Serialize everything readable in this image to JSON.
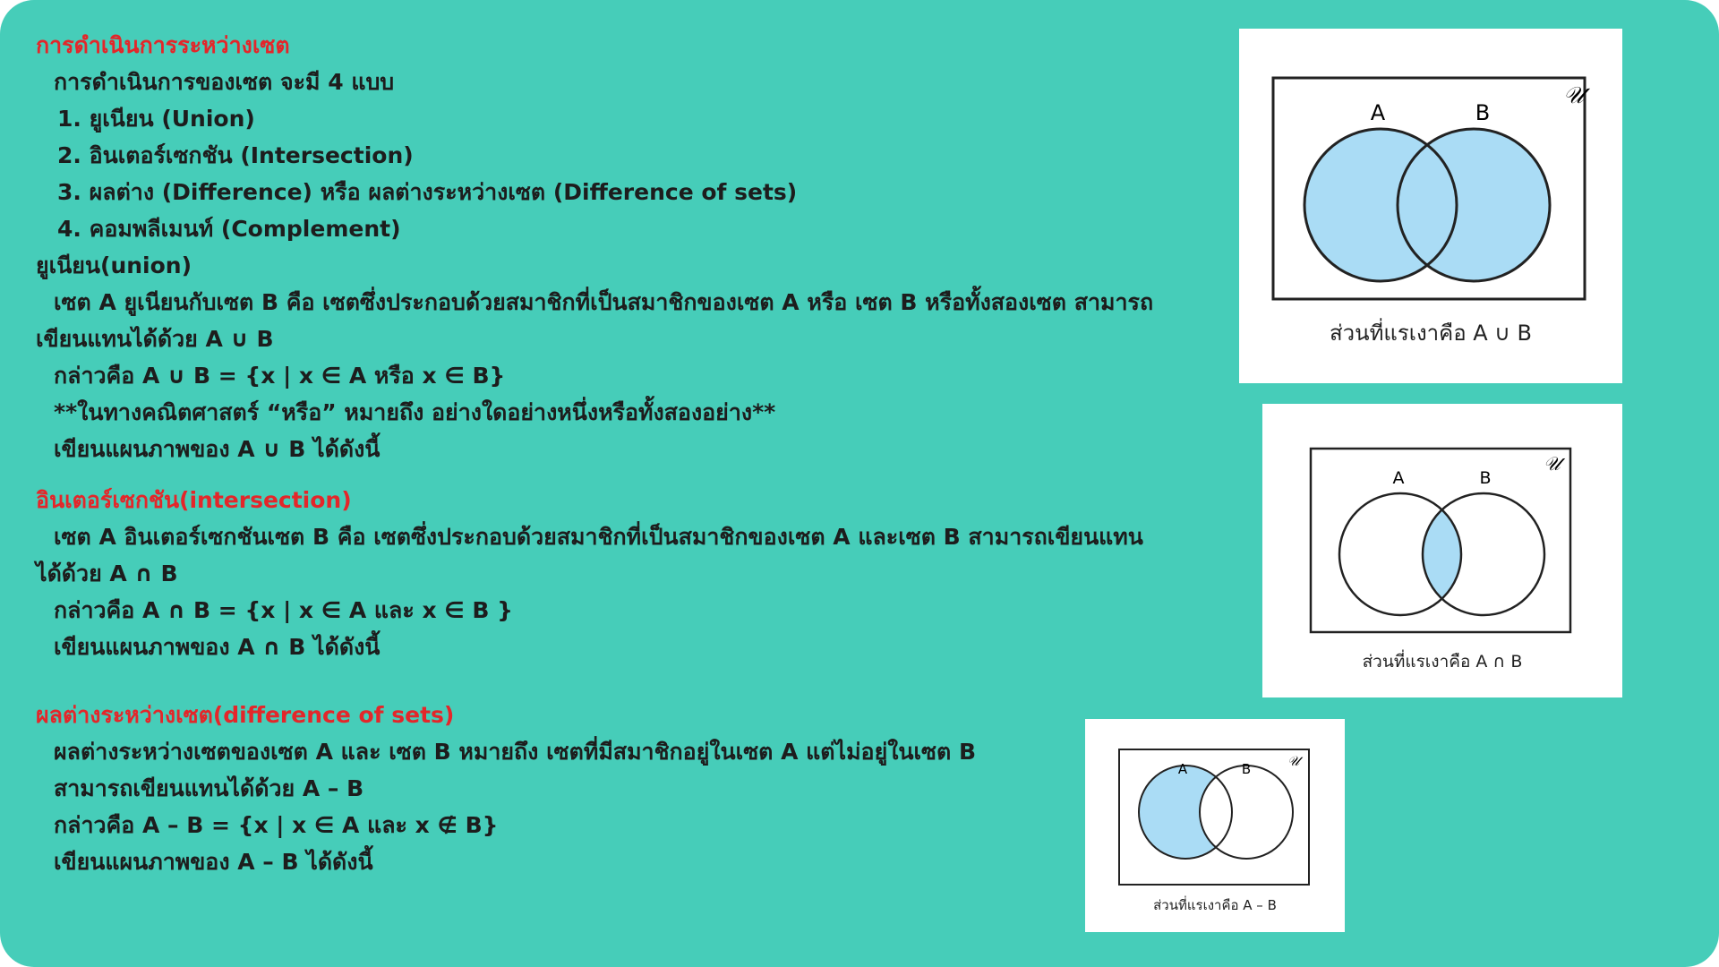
{
  "section1": {
    "heading": "การดำเนินการระหว่างเซต",
    "intro": "การดำเนินการของเซต จะมี 4 แบบ",
    "items": [
      "1. ยูเนียน (Union)",
      "2. อินเตอร์เซกชัน (Intersection)",
      "3. ผลต่าง (Difference) หรือ ผลต่างระหว่างเซต (Difference of sets)",
      "4. คอมพลีเมนท์ (Complement)"
    ]
  },
  "union": {
    "heading": "ยูเนียน(union)",
    "line1": "เซต A ยูเนียนกับเซต B คือ เซตซึ่งประกอบด้วยสมาชิกที่เป็นสมาชิกของเซต A หรือ เซต B หรือทั้งสองเซต สามารถ",
    "line2": "เขียนแทนได้ด้วย A ∪ B",
    "line3": "กล่าวคือ A ∪ B = {x | x ∈ A หรือ x ∈ B}",
    "line4": "**ในทางคณิตศาสตร์ “หรือ” หมายถึง อย่างใดอย่างหนึ่งหรือทั้งสองอย่าง**",
    "line5": "เขียนแผนภาพของ A ∪ B ได้ดังนี้"
  },
  "intersection": {
    "heading": "อินเตอร์เซกชัน(intersection)",
    "line1": "เซต A อินเตอร์เซกชันเซต B คือ เซตซึ่งประกอบด้วยสมาชิกที่เป็นสมาชิกของเซต A และเซต B สามารถเขียนแทน",
    "line2": "ได้ด้วย A ∩ B",
    "line3": "กล่าวคือ A ∩ B = {x | x ∈ A และ x ∈ B }",
    "line4": "เขียนแผนภาพของ A ∩ B ได้ดังนี้"
  },
  "difference": {
    "heading": "ผลต่างระหว่างเซต(difference of sets)",
    "line1": "ผลต่างระหว่างเซตของเซต A และ เซต B หมายถึง เซตที่มีสมาชิกอยู่ในเซต A แต่ไม่อยู่ในเซต B",
    "line2": "สามารถเขียนแทนได้ด้วย A – B",
    "line3": "กล่าวคือ A – B = {x | x ∈ A และ x ∉ B}",
    "line4": "เขียนแผนภาพของ A – B ได้ดังนี้"
  },
  "diagrams": {
    "label_a": "A",
    "label_b": "B",
    "universe": "𝒰",
    "union_caption": "ส่วนที่แรเงาคือ A ∪ B",
    "intersection_caption": "ส่วนที่แรเงาคือ A ∩ B",
    "difference_caption": "ส่วนที่แรเงาคือ A – B"
  },
  "colors": {
    "background": "#46cdb9",
    "heading": "#e4262a",
    "shade": "#aadcf5"
  }
}
